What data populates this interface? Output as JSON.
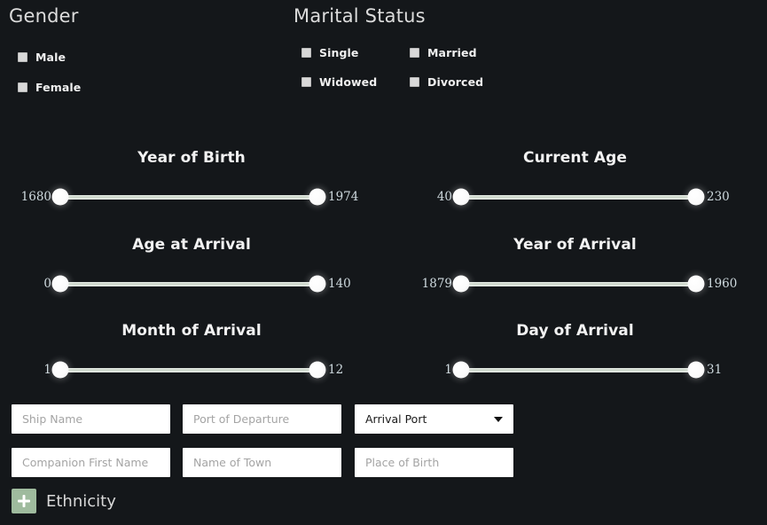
{
  "theme": {
    "background": "#14171a",
    "accent_green": "#9fbb9e",
    "field_background": "#ffffff",
    "slider_track": "#c8d4c6",
    "heading_color": "#dcdcdc"
  },
  "gender": {
    "heading": "Gender",
    "options": [
      {
        "label": "Male",
        "checked": false
      },
      {
        "label": "Female",
        "checked": false
      }
    ]
  },
  "marital_status": {
    "heading": "Marital Status",
    "options": [
      {
        "label": "Single",
        "checked": false
      },
      {
        "label": "Married",
        "checked": false
      },
      {
        "label": "Widowed",
        "checked": false
      },
      {
        "label": "Divorced",
        "checked": false
      }
    ]
  },
  "sliders": [
    {
      "title": "Year of Birth",
      "min": "1680",
      "max": "1974"
    },
    {
      "title": "Current Age",
      "min": "40",
      "max": "230"
    },
    {
      "title": "Age at Arrival",
      "min": "0",
      "max": "140"
    },
    {
      "title": "Year of Arrival",
      "min": "1879",
      "max": "1960"
    },
    {
      "title": "Month of Arrival",
      "min": "1",
      "max": "12"
    },
    {
      "title": "Day of Arrival",
      "min": "1",
      "max": "31"
    }
  ],
  "fields": {
    "ship_name": {
      "value": "",
      "placeholder": "Ship Name"
    },
    "port_of_departure": {
      "value": "",
      "placeholder": "Port of Departure"
    },
    "companion_first": {
      "value": "",
      "placeholder": "Companion First Name"
    },
    "name_of_town": {
      "value": "",
      "placeholder": "Name of Town"
    },
    "place_of_birth": {
      "value": "",
      "placeholder": "Place of Birth"
    }
  },
  "arrival_port_select": {
    "selected": "Arrival Port",
    "icon": "chevron-down-icon"
  },
  "ethnicity": {
    "label": "Ethnicity",
    "button_icon": "plus-icon"
  }
}
